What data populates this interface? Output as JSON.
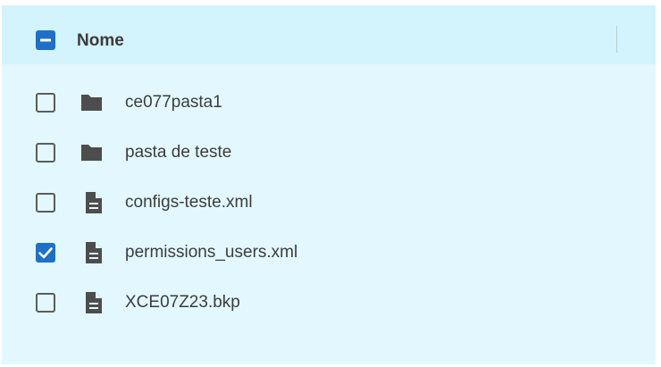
{
  "table": {
    "header": {
      "select_all_state": "indeterminate",
      "column_label": "Nome"
    },
    "rows": [
      {
        "name": "ce077pasta1",
        "type": "folder",
        "icon": "folder-icon",
        "checked": false
      },
      {
        "name": "pasta de teste",
        "type": "folder",
        "icon": "folder-icon",
        "checked": false
      },
      {
        "name": "configs-teste.xml",
        "type": "file",
        "icon": "file-icon",
        "checked": false
      },
      {
        "name": "permissions_users.xml",
        "type": "file",
        "icon": "file-icon",
        "checked": true
      },
      {
        "name": "XCE07Z23.bkp",
        "type": "file",
        "icon": "file-icon",
        "checked": false
      }
    ]
  },
  "colors": {
    "accent": "#1e6fc8",
    "header_bg": "#d3f3fd",
    "body_bg": "#e2f8fe",
    "icon": "#4d4d4d",
    "text": "#3d3d3d"
  }
}
